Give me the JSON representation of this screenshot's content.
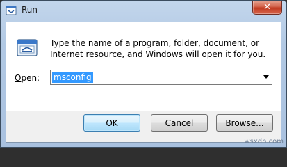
{
  "window": {
    "title": "Run",
    "close_glyph": "✕"
  },
  "description": "Type the name of a program, folder, document, or Internet resource, and Windows will open it for you.",
  "open": {
    "label_accel": "O",
    "label_rest": "pen:",
    "value": "msconfig"
  },
  "buttons": {
    "ok_label": "OK",
    "cancel_label": "Cancel",
    "browse_accel": "B",
    "browse_rest": "rowse..."
  },
  "watermark": "wsxdn.com",
  "colors": {
    "selection": "#3399ff",
    "close_button": "#c0391f"
  },
  "icons": {
    "title": "run-dialog-icon",
    "main": "run-program-icon"
  }
}
